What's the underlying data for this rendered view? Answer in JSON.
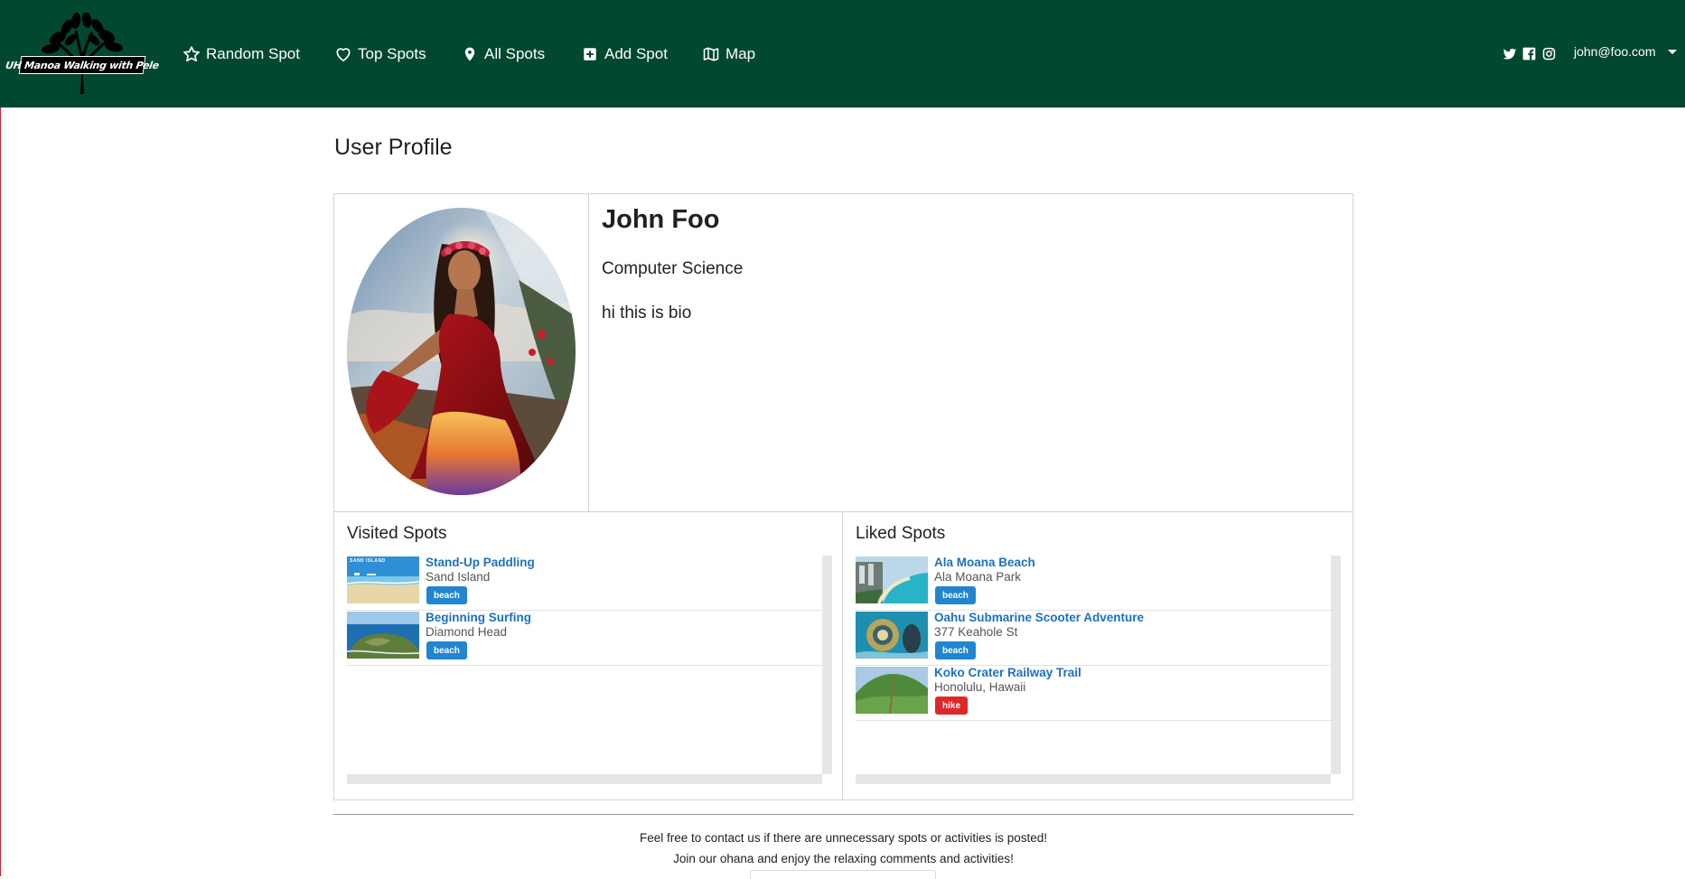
{
  "app": {
    "logo_text": "UH Manoa Walking with Pele"
  },
  "nav": {
    "items": [
      {
        "label": "Random Spot",
        "icon": "star-outline-icon"
      },
      {
        "label": "Top Spots",
        "icon": "heart-outline-icon"
      },
      {
        "label": "All Spots",
        "icon": "map-marker-icon"
      },
      {
        "label": "Add Spot",
        "icon": "plus-square-icon"
      },
      {
        "label": "Map",
        "icon": "map-outline-icon"
      }
    ],
    "social": [
      "twitter-icon",
      "facebook-icon",
      "instagram-icon"
    ],
    "user_email": "john@foo.com"
  },
  "page": {
    "title": "User Profile"
  },
  "profile": {
    "name": "John Foo",
    "major": "Computer Science",
    "bio": "hi this is bio"
  },
  "visited": {
    "title": "Visited Spots",
    "items": [
      {
        "name": "Stand-Up Paddling",
        "location": "Sand Island",
        "tag": "beach",
        "thumb_caption": "SAND ISLAND"
      },
      {
        "name": "Beginning Surfing",
        "location": "Diamond Head",
        "tag": "beach"
      }
    ]
  },
  "liked": {
    "title": "Liked Spots",
    "items": [
      {
        "name": "Ala Moana Beach",
        "location": "Ala Moana Park",
        "tag": "beach"
      },
      {
        "name": "Oahu Submarine Scooter Adventure",
        "location": "377 Keahole St",
        "tag": "beach"
      },
      {
        "name": "Koko Crater Railway Trail",
        "location": "Honolulu, Hawaii",
        "tag": "hike"
      }
    ]
  },
  "footer": {
    "line1": "Feel free to contact us if there are unnecessary spots or activities is posted!",
    "line2": "Join our ohana and enjoy the relaxing comments and activities!"
  },
  "colors": {
    "navbar": "#024731",
    "link": "#1e70bf",
    "tag_beach": "#2185d0",
    "tag_hike": "#db2828"
  }
}
